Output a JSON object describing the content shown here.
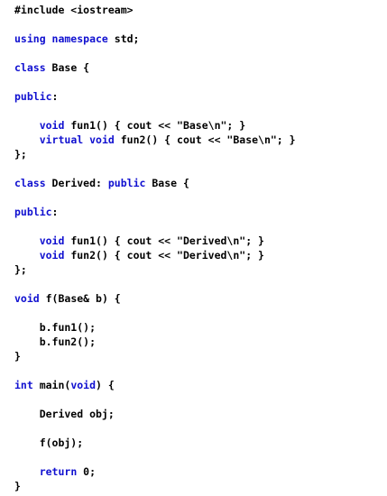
{
  "code": {
    "lines": [
      [
        {
          "t": "#include <iostream>",
          "k": false
        }
      ],
      [],
      [
        {
          "t": "using namespace",
          "k": true
        },
        {
          "t": " std;",
          "k": false
        }
      ],
      [],
      [
        {
          "t": "class",
          "k": true
        },
        {
          "t": " Base {",
          "k": false
        }
      ],
      [],
      [
        {
          "t": "public",
          "k": true
        },
        {
          "t": ":",
          "k": false
        }
      ],
      [],
      [
        {
          "t": "    ",
          "k": false
        },
        {
          "t": "void",
          "k": true
        },
        {
          "t": " fun1() { cout << \"Base\\n\"; }",
          "k": false
        }
      ],
      [
        {
          "t": "    ",
          "k": false
        },
        {
          "t": "virtual void",
          "k": true
        },
        {
          "t": " fun2() { cout << \"Base\\n\"; }",
          "k": false
        }
      ],
      [
        {
          "t": "};",
          "k": false
        }
      ],
      [],
      [
        {
          "t": "class",
          "k": true
        },
        {
          "t": " Derived: ",
          "k": false
        },
        {
          "t": "public",
          "k": true
        },
        {
          "t": " Base {",
          "k": false
        }
      ],
      [],
      [
        {
          "t": "public",
          "k": true
        },
        {
          "t": ":",
          "k": false
        }
      ],
      [],
      [
        {
          "t": "    ",
          "k": false
        },
        {
          "t": "void",
          "k": true
        },
        {
          "t": " fun1() { cout << \"Derived\\n\"; }",
          "k": false
        }
      ],
      [
        {
          "t": "    ",
          "k": false
        },
        {
          "t": "void",
          "k": true
        },
        {
          "t": " fun2() { cout << \"Derived\\n\"; }",
          "k": false
        }
      ],
      [
        {
          "t": "};",
          "k": false
        }
      ],
      [],
      [
        {
          "t": "void",
          "k": true
        },
        {
          "t": " f(Base& b) {",
          "k": false
        }
      ],
      [],
      [
        {
          "t": "    b.fun1();",
          "k": false
        }
      ],
      [
        {
          "t": "    b.fun2();",
          "k": false
        }
      ],
      [
        {
          "t": "}",
          "k": false
        }
      ],
      [],
      [
        {
          "t": "int",
          "k": true
        },
        {
          "t": " main(",
          "k": false
        },
        {
          "t": "void",
          "k": true
        },
        {
          "t": ") {",
          "k": false
        }
      ],
      [],
      [
        {
          "t": "    Derived obj;",
          "k": false
        }
      ],
      [],
      [
        {
          "t": "    f(obj);",
          "k": false
        }
      ],
      [],
      [
        {
          "t": "    ",
          "k": false
        },
        {
          "t": "return",
          "k": true
        },
        {
          "t": " 0;",
          "k": false
        }
      ],
      [
        {
          "t": "}",
          "k": false
        }
      ]
    ]
  },
  "colors": {
    "keyword": "#1010d0",
    "text": "#000000",
    "background": "#ffffff"
  }
}
